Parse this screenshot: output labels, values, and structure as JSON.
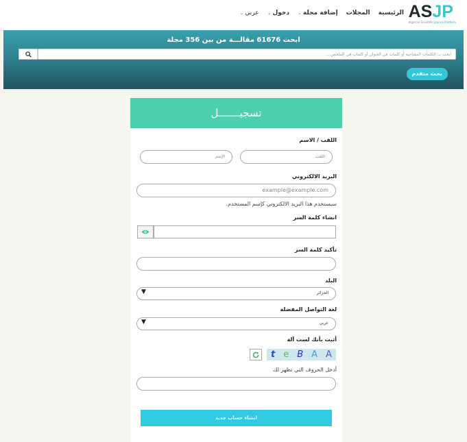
{
  "logo": {
    "brand_a": "AS",
    "brand_b": "JP",
    "tagline_a": "Algerian Scientific",
    "tagline_b": "Journal Platform"
  },
  "nav": {
    "items": [
      {
        "label": "الرئيسية",
        "has_dropdown": false
      },
      {
        "label": "المجلات",
        "has_dropdown": false
      },
      {
        "label": "إضافة مجلة",
        "has_dropdown": true
      },
      {
        "label": "دخول",
        "has_dropdown": true
      },
      {
        "label": "عربي",
        "has_dropdown": true
      }
    ]
  },
  "search": {
    "title": "ابحث 61676 مقالـــة من بين 356 مجلة",
    "placeholder": "ابحث بـ: الكلمات المفتاحية أو كلمات في العنوان أو كلمات في الملخص...",
    "advanced_label": "بحث متقدم",
    "search_icon": "magnifier-icon"
  },
  "form": {
    "heading": "تسجيـــــــل",
    "name_label": "اللقب / الاسم",
    "lastname_placeholder": "اللقب",
    "firstname_placeholder": "الإسم",
    "email_label": "البريد الالكتروني",
    "email_placeholder": "example@example.com",
    "email_help": "سيستخدم هذا البريد الالكتروني كإسم المستخدم.",
    "password_label": "انشاء كلمة السر",
    "confirm_label": "تأكيد كلمة السر",
    "country_label": "البلد",
    "country_value": "الجزائر",
    "lang_label": "لغة التواصل المفضلة",
    "lang_value": "عربي",
    "captcha_label": "أثبت بأنك لست آلة",
    "captcha_chars": [
      "t",
      "e",
      "B",
      "A",
      "A"
    ],
    "captcha_help": "أدخل الحروف التي تظهر لك",
    "submit_label": "انشاء حساب جديد"
  },
  "colors": {
    "header_green": "#4dd0ad",
    "accent_cyan": "#32c9e2",
    "hero_top": "#3aa0ad",
    "hero_bottom": "#22545f"
  }
}
